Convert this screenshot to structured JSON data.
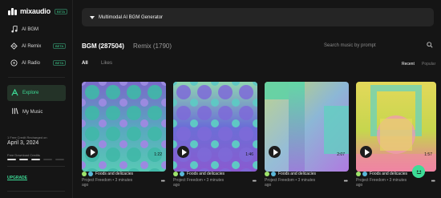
{
  "brand": {
    "name": "mixaudio",
    "badge": "BETA"
  },
  "nav": [
    {
      "label": "AI BGM",
      "icon": "music-note-icon",
      "badge": ""
    },
    {
      "label": "AI Remix",
      "icon": "remix-icon",
      "badge": "BETA"
    },
    {
      "label": "AI Radio",
      "icon": "radio-icon",
      "badge": "BETA"
    }
  ],
  "explore_label": "Explore",
  "mymusic_label": "My Music",
  "credit": {
    "label": "1 Free Credit Recharged on",
    "date": "April 3, 2024",
    "free_label": "Free Download Credits"
  },
  "upgrade_label": "UPGRADE",
  "generator_label": "Multimodal AI BGM Generator",
  "tabs": {
    "bgm": "BGM (287504)",
    "remix": "Remix (1790)"
  },
  "search_placeholder": "Search music by prompt",
  "filters": {
    "all": "All",
    "likes": "Likes"
  },
  "sort": {
    "recent": "Recent",
    "popular": "Popular"
  },
  "cards": [
    {
      "title": "Foods and delicacies",
      "by": "Project Freedom • 3 minutes",
      "ago": "ago",
      "duration": "1:22"
    },
    {
      "title": "Foods and delicacies",
      "by": "Project Freedom • 3 minutes",
      "ago": "ago",
      "duration": "1:46"
    },
    {
      "title": "Foods and delicacies",
      "by": "Project Freedom • 3 minutes",
      "ago": "ago",
      "duration": "2:07"
    },
    {
      "title": "Foods and delicacies",
      "by": "Project Freedom • 3 minutes",
      "ago": "ago",
      "duration": "1:57"
    }
  ],
  "colors": {
    "accent": "#3ddc97",
    "sidebar_active": "#243328",
    "card_bg": "#1d1d1d"
  }
}
